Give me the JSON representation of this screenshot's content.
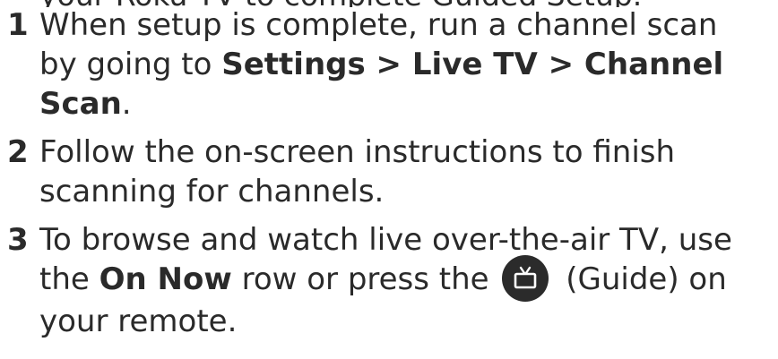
{
  "top_fragment": "your Roku TV to complete Guided Setup.",
  "steps": [
    {
      "number": "1",
      "line1": "When setup is complete, run a channel scan",
      "line2_prefix": "by going to ",
      "menu_path": "Settings > Live TV > Channel",
      "menu_path_end": "Scan",
      "end_punct": "."
    },
    {
      "number": "2",
      "line1": "Follow the on-screen instructions to finish",
      "line2": "scanning for channels."
    },
    {
      "number": "3",
      "line1": "To browse and watch live over-the-air TV, use",
      "line2_prefix": "the ",
      "row_name": "On Now",
      "line2_mid": " row or press the ",
      "guide_label": " (Guide) on",
      "line3": "your remote."
    }
  ],
  "icons": {
    "guide": "tv-guide-icon"
  },
  "colors": {
    "text": "#2a2a2a",
    "icon_bg": "#2b2b2b",
    "icon_fg": "#ffffff"
  }
}
